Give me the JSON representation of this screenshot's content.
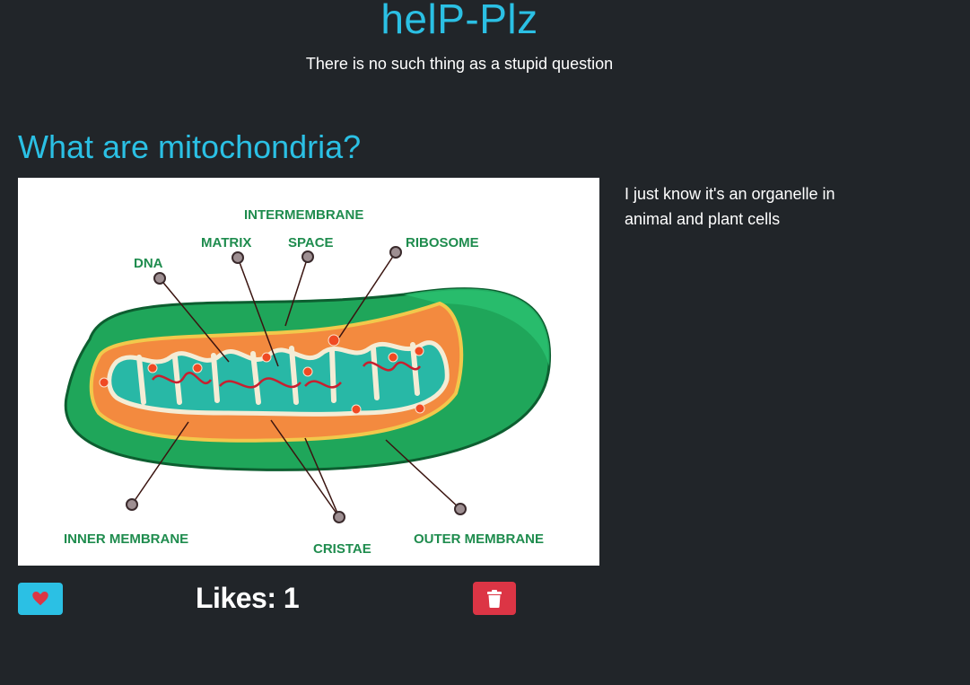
{
  "header": {
    "title": "helP-Plz",
    "subtitle": "There is no such thing as a stupid question"
  },
  "question": {
    "title": "What are mitochondria?",
    "body": "I just know it's an organelle in animal and plant cells",
    "image": {
      "labels": {
        "intermembrane": "INTERMEMBRANE",
        "space": "SPACE",
        "matrix": "MATRIX",
        "ribosome": "RIBOSOME",
        "dna": "DNA",
        "inner_membrane": "INNER MEMBRANE",
        "cristae": "CRISTAE",
        "outer_membrane": "OUTER MEMBRANE"
      }
    },
    "likes_text": "Likes: 1",
    "like_icon": "heart-icon",
    "delete_icon": "trash-icon"
  },
  "colors": {
    "background": "#212529",
    "accent": "#2bc0e4",
    "danger": "#dc3545",
    "text": "#ffffff"
  }
}
